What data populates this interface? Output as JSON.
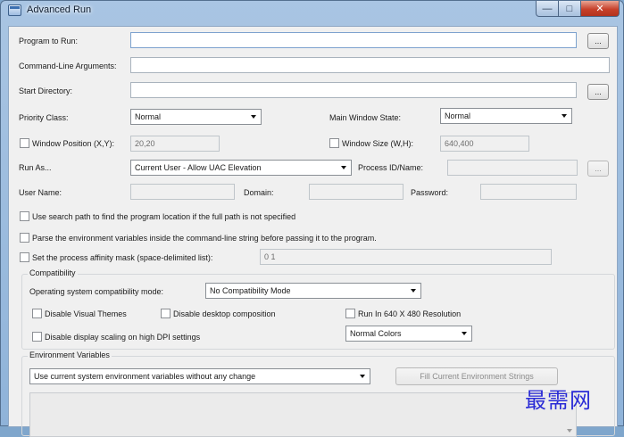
{
  "window": {
    "title": "Advanced Run",
    "min_glyph": "—",
    "max_glyph": "□",
    "close_glyph": "✕"
  },
  "form": {
    "program_label": "Program to Run:",
    "program_value": "",
    "browse_label": "...",
    "cmd_args_label": "Command-Line Arguments:",
    "cmd_args_value": "",
    "start_dir_label": "Start Directory:",
    "start_dir_value": "",
    "priority_label": "Priority Class:",
    "priority_value": "Normal",
    "main_window_state_label": "Main Window State:",
    "main_window_state_value": "Normal",
    "window_pos_label": "Window Position (X,Y):",
    "window_pos_value": "20,20",
    "window_size_label": "Window Size (W,H):",
    "window_size_value": "640,400",
    "run_as_label": "Run As...",
    "run_as_value": "Current User - Allow UAC Elevation",
    "process_id_label": "Process ID/Name:",
    "process_id_value": "",
    "user_name_label": "User Name:",
    "domain_label": "Domain:",
    "password_label": "Password:",
    "search_path_label": "Use search path to find the program location if the full path is not specified",
    "parse_env_label": "Parse the environment variables inside the command-line string before passing it to the program.",
    "affinity_label": "Set the process affinity mask (space-delimited list):",
    "affinity_value": "0 1"
  },
  "compatibility": {
    "group_label": "Compatibility",
    "os_mode_label": "Operating system compatibility mode:",
    "os_mode_value": "No Compatibility Mode",
    "disable_themes_label": "Disable Visual Themes",
    "disable_composition_label": "Disable desktop composition",
    "run_640_label": "Run In 640 X 480 Resolution",
    "disable_dpi_label": "Disable display scaling on high DPI settings",
    "colors_value": "Normal Colors"
  },
  "environment": {
    "group_label": "Environment Variables",
    "mode_value": "Use current system environment variables without any change",
    "fill_button_label": "Fill Current Environment Strings"
  },
  "watermark": "最需网"
}
